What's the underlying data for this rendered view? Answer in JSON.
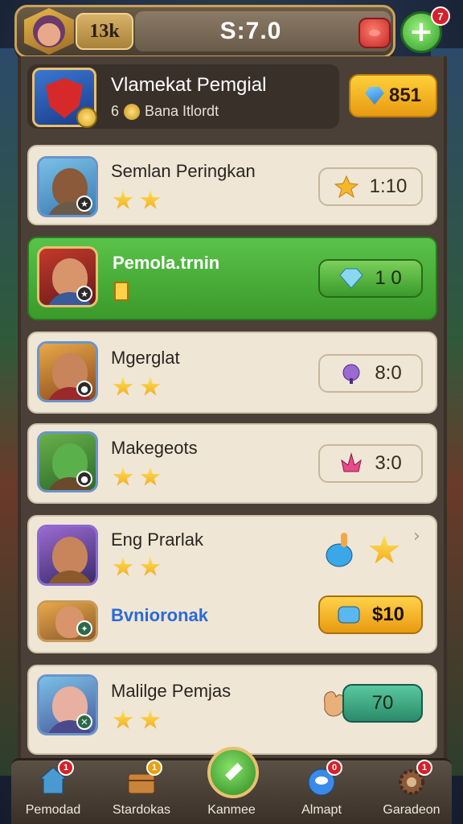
{
  "top_bar": {
    "level_label": "13k",
    "balance": "S:7.0",
    "add_badge": "7"
  },
  "header": {
    "title": "Vlamekat Pemgial",
    "subtitle_prefix": "6",
    "subtitle": "Bana Itlordt",
    "gem_total": "851"
  },
  "heroes": [
    {
      "name": "Semlan Peringkan",
      "stars": 2,
      "price": "1:10",
      "price_icon": "star-icon",
      "style": "plain"
    },
    {
      "name": "Pemola.trnin",
      "stars": 0,
      "price": "1 0",
      "price_icon": "gem-icon",
      "style": "selected"
    },
    {
      "name": "Mgerglat",
      "stars": 2,
      "price": "8:0",
      "price_icon": "potion-icon",
      "style": "plain"
    },
    {
      "name": "Makegeots",
      "stars": 2,
      "price": "3:0",
      "price_icon": "crystal-icon",
      "style": "plain"
    },
    {
      "name": "Eng Prarlak",
      "stars": 2,
      "price": "",
      "price_icon": "",
      "style": "plain"
    },
    {
      "name": "Bvnioronak",
      "stars": 0,
      "price": "$10",
      "price_icon": "gem-icon",
      "style": "gold"
    },
    {
      "name": "Malilge Pemjas",
      "stars": 2,
      "price": "70",
      "price_icon": "hand-icon",
      "style": "teal"
    }
  ],
  "nav": [
    {
      "label": "Pemodad",
      "icon": "home-icon",
      "badge": "1"
    },
    {
      "label": "Stardokas",
      "icon": "chest-icon",
      "badge": "1"
    },
    {
      "label": "Kanmee",
      "icon": "leaf-icon",
      "badge": ""
    },
    {
      "label": "Almapt",
      "icon": "orb-icon",
      "badge": "0"
    },
    {
      "label": "Garadeon",
      "icon": "gear-icon",
      "badge": "1"
    }
  ],
  "colors": {
    "accent_gold": "#e89a10",
    "selected_green": "#3a9a2a",
    "badge_red": "#d6202a"
  }
}
